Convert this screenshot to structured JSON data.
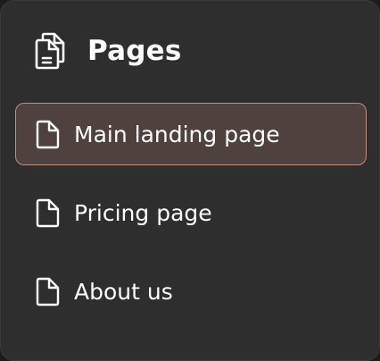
{
  "header": {
    "title": "Pages",
    "icon": "pages-icon"
  },
  "nav": {
    "items": [
      {
        "label": "Main landing page",
        "icon": "file-icon",
        "active": true
      },
      {
        "label": "Pricing page",
        "icon": "file-icon",
        "active": false
      },
      {
        "label": "About us",
        "icon": "file-icon",
        "active": false
      }
    ]
  },
  "colors": {
    "panel_background": "#2e2e2e",
    "active_background": "#4f413d",
    "active_border": "#c08e7f",
    "text": "#ffffff"
  }
}
